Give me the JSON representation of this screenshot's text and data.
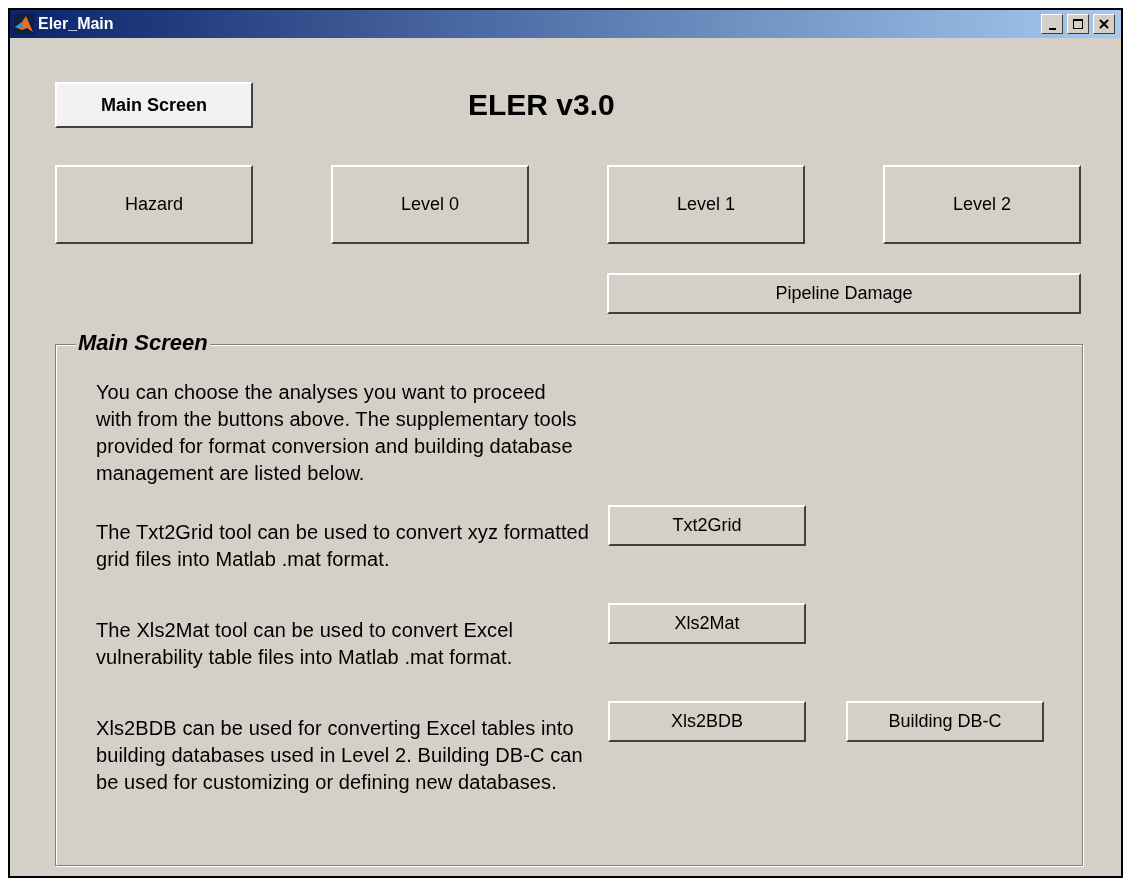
{
  "window": {
    "title": "Eler_Main"
  },
  "main_button": {
    "label": "Main Screen",
    "selected": true
  },
  "heading": "ELER v3.0",
  "analysis_buttons": [
    {
      "label": "Hazard"
    },
    {
      "label": "Level 0"
    },
    {
      "label": "Level 1"
    },
    {
      "label": "Level 2"
    }
  ],
  "pipeline_button": {
    "label": "Pipeline Damage"
  },
  "panel": {
    "title": "Main Screen",
    "intro": "You can choose the analyses you want to proceed with from the buttons above. The supplementary tools provided for format conversion and building database management are listed below.",
    "tools": [
      {
        "description": "The Txt2Grid tool can be used to convert xyz formatted grid files into Matlab .mat format.",
        "buttons": [
          "Txt2Grid"
        ]
      },
      {
        "description": "The Xls2Mat tool can be used to convert Excel vulnerability table files into Matlab .mat format.",
        "buttons": [
          "Xls2Mat"
        ]
      },
      {
        "description": "Xls2BDB can be used for converting Excel tables into building databases used in Level 2. Building DB-C can be used for customizing or defining new databases.",
        "buttons": [
          "Xls2BDB",
          "Building DB-C"
        ]
      }
    ]
  }
}
